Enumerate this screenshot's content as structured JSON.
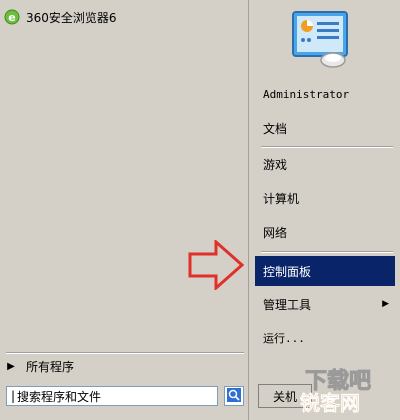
{
  "pinned_programs": [
    {
      "label": "360安全浏览器6",
      "icon": "browser-e-icon"
    }
  ],
  "all_programs": {
    "label": "所有程序",
    "icon": "triangle-right-icon"
  },
  "search": {
    "placeholder": "搜索程序和文件",
    "value": "",
    "icon": "search-icon"
  },
  "user_tile": {
    "icon": "control-panel-picture-icon"
  },
  "right_menu": {
    "username": "Administrator",
    "documents": "文档",
    "games": "游戏",
    "computer": "计算机",
    "network": "网络",
    "control_panel": "控制面板",
    "admin_tools": "管理工具",
    "run": "运行..."
  },
  "shutdown": {
    "label": "关机"
  },
  "watermark": {
    "text": "锐客网",
    "overlay_text": "下载吧"
  },
  "colors": {
    "menu_background": "#d4d0c8",
    "highlight": "#0a246a",
    "annotation_arrow": "#e0302a"
  }
}
